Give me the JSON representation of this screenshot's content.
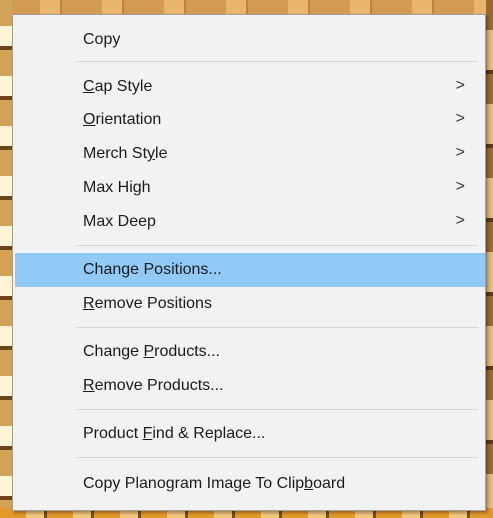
{
  "menu": {
    "items": [
      {
        "prefix": "",
        "accel": "",
        "suffix": "Copy",
        "submenu": false,
        "highlighted": false
      },
      {
        "prefix": "",
        "accel": "C",
        "suffix": "ap Style",
        "submenu": true,
        "highlighted": false
      },
      {
        "prefix": "",
        "accel": "O",
        "suffix": "rientation",
        "submenu": true,
        "highlighted": false
      },
      {
        "prefix": "Merch St",
        "accel": "y",
        "suffix": "le",
        "submenu": true,
        "highlighted": false
      },
      {
        "prefix": "Max High",
        "accel": "",
        "suffix": "",
        "submenu": true,
        "highlighted": false
      },
      {
        "prefix": "Max Deep",
        "accel": "",
        "suffix": "",
        "submenu": true,
        "highlighted": false
      },
      {
        "prefix": "Change Positions...",
        "accel": "",
        "suffix": "",
        "submenu": false,
        "highlighted": true
      },
      {
        "prefix": "",
        "accel": "R",
        "suffix": "emove Positions",
        "submenu": false,
        "highlighted": false
      },
      {
        "prefix": "Change ",
        "accel": "P",
        "suffix": "roducts...",
        "submenu": false,
        "highlighted": false
      },
      {
        "prefix": "",
        "accel": "R",
        "suffix": "emove Products...",
        "submenu": false,
        "highlighted": false
      },
      {
        "prefix": "Product ",
        "accel": "F",
        "suffix": "ind & Replace...",
        "submenu": false,
        "highlighted": false
      },
      {
        "prefix": "Copy Planogram Image To Clip",
        "accel": "b",
        "suffix": "oard",
        "submenu": false,
        "highlighted": false
      }
    ],
    "submenu_glyph": ">",
    "highlight_color": "#91c9f7"
  }
}
